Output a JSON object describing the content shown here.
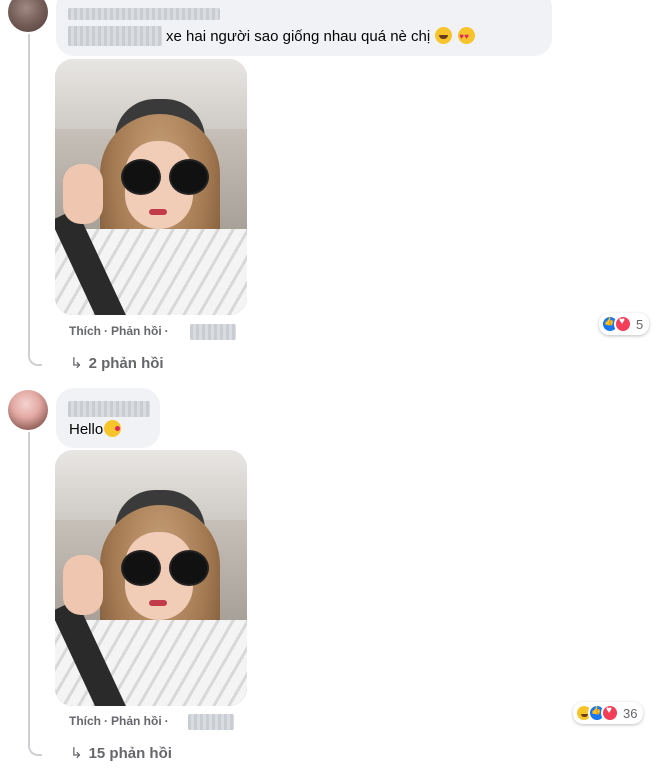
{
  "comments": [
    {
      "text": "xe hai người sao giống nhau quá nè chị",
      "emojis": [
        "rolling-on-floor-laughing",
        "heart-eyes"
      ],
      "actions": {
        "like": "Thích",
        "reply": "Phản hồi",
        "separator": "·"
      },
      "reactions": {
        "icons": [
          "like",
          "love"
        ],
        "count": "5"
      },
      "view_replies": "2 phản hồi"
    },
    {
      "text": "Hello",
      "emojis": [
        "face-blowing-kiss"
      ],
      "actions": {
        "like": "Thích",
        "reply": "Phản hồi",
        "separator": "·"
      },
      "reactions": {
        "icons": [
          "haha",
          "like",
          "love"
        ],
        "count": "36"
      },
      "view_replies": "15 phản hồi"
    }
  ],
  "icons": {
    "reply_arrow": "reply-arrow-icon"
  },
  "colors": {
    "bubble": "#f0f2f5",
    "secondary_text": "#65676b",
    "like_blue": "#1877f2",
    "love_red": "#f33e58"
  }
}
